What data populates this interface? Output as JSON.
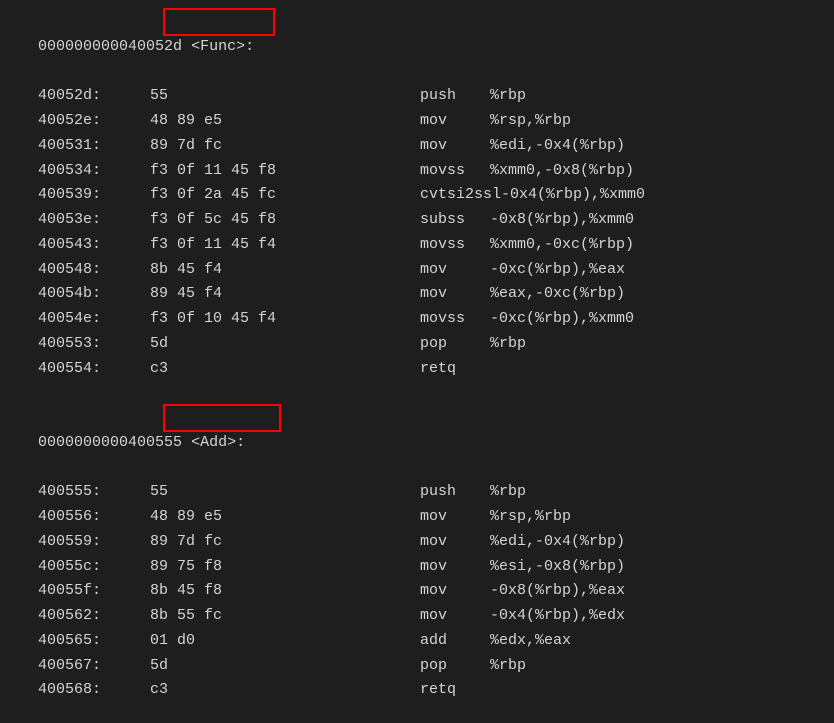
{
  "func1": {
    "addr": "000000000040052d",
    "name": "<Func>:",
    "lines": [
      {
        "addr": "40052d:",
        "bytes": "55",
        "mn": "push",
        "ops": "%rbp"
      },
      {
        "addr": "40052e:",
        "bytes": "48 89 e5",
        "mn": "mov",
        "ops": "%rsp,%rbp"
      },
      {
        "addr": "400531:",
        "bytes": "89 7d fc",
        "mn": "mov",
        "ops": "%edi,-0x4(%rbp)"
      },
      {
        "addr": "400534:",
        "bytes": "f3 0f 11 45 f8",
        "mn": "movss",
        "ops": "%xmm0,-0x8(%rbp)"
      },
      {
        "addr": "400539:",
        "bytes": "f3 0f 2a 45 fc",
        "mn": "cvtsi2ssl",
        "ops": "-0x4(%rbp),%xmm0"
      },
      {
        "addr": "40053e:",
        "bytes": "f3 0f 5c 45 f8",
        "mn": "subss",
        "ops": "-0x8(%rbp),%xmm0"
      },
      {
        "addr": "400543:",
        "bytes": "f3 0f 11 45 f4",
        "mn": "movss",
        "ops": "%xmm0,-0xc(%rbp)"
      },
      {
        "addr": "400548:",
        "bytes": "8b 45 f4",
        "mn": "mov",
        "ops": "-0xc(%rbp),%eax"
      },
      {
        "addr": "40054b:",
        "bytes": "89 45 f4",
        "mn": "mov",
        "ops": "%eax,-0xc(%rbp)"
      },
      {
        "addr": "40054e:",
        "bytes": "f3 0f 10 45 f4",
        "mn": "movss",
        "ops": "-0xc(%rbp),%xmm0"
      },
      {
        "addr": "400553:",
        "bytes": "5d",
        "mn": "pop",
        "ops": "%rbp"
      },
      {
        "addr": "400554:",
        "bytes": "c3",
        "mn": "retq",
        "ops": ""
      }
    ]
  },
  "func2": {
    "addr": "0000000000400555",
    "name": "<Add>:",
    "lines": [
      {
        "addr": "400555:",
        "bytes": "55",
        "mn": "push",
        "ops": "%rbp"
      },
      {
        "addr": "400556:",
        "bytes": "48 89 e5",
        "mn": "mov",
        "ops": "%rsp,%rbp"
      },
      {
        "addr": "400559:",
        "bytes": "89 7d fc",
        "mn": "mov",
        "ops": "%edi,-0x4(%rbp)"
      },
      {
        "addr": "40055c:",
        "bytes": "89 75 f8",
        "mn": "mov",
        "ops": "%esi,-0x8(%rbp)"
      },
      {
        "addr": "40055f:",
        "bytes": "8b 45 f8",
        "mn": "mov",
        "ops": "-0x8(%rbp),%eax"
      },
      {
        "addr": "400562:",
        "bytes": "8b 55 fc",
        "mn": "mov",
        "ops": "-0x4(%rbp),%edx"
      },
      {
        "addr": "400565:",
        "bytes": "01 d0",
        "mn": "add",
        "ops": "%edx,%eax"
      },
      {
        "addr": "400567:",
        "bytes": "5d",
        "mn": "pop",
        "ops": "%rbp"
      },
      {
        "addr": "400568:",
        "bytes": "c3",
        "mn": "retq",
        "ops": ""
      }
    ]
  }
}
